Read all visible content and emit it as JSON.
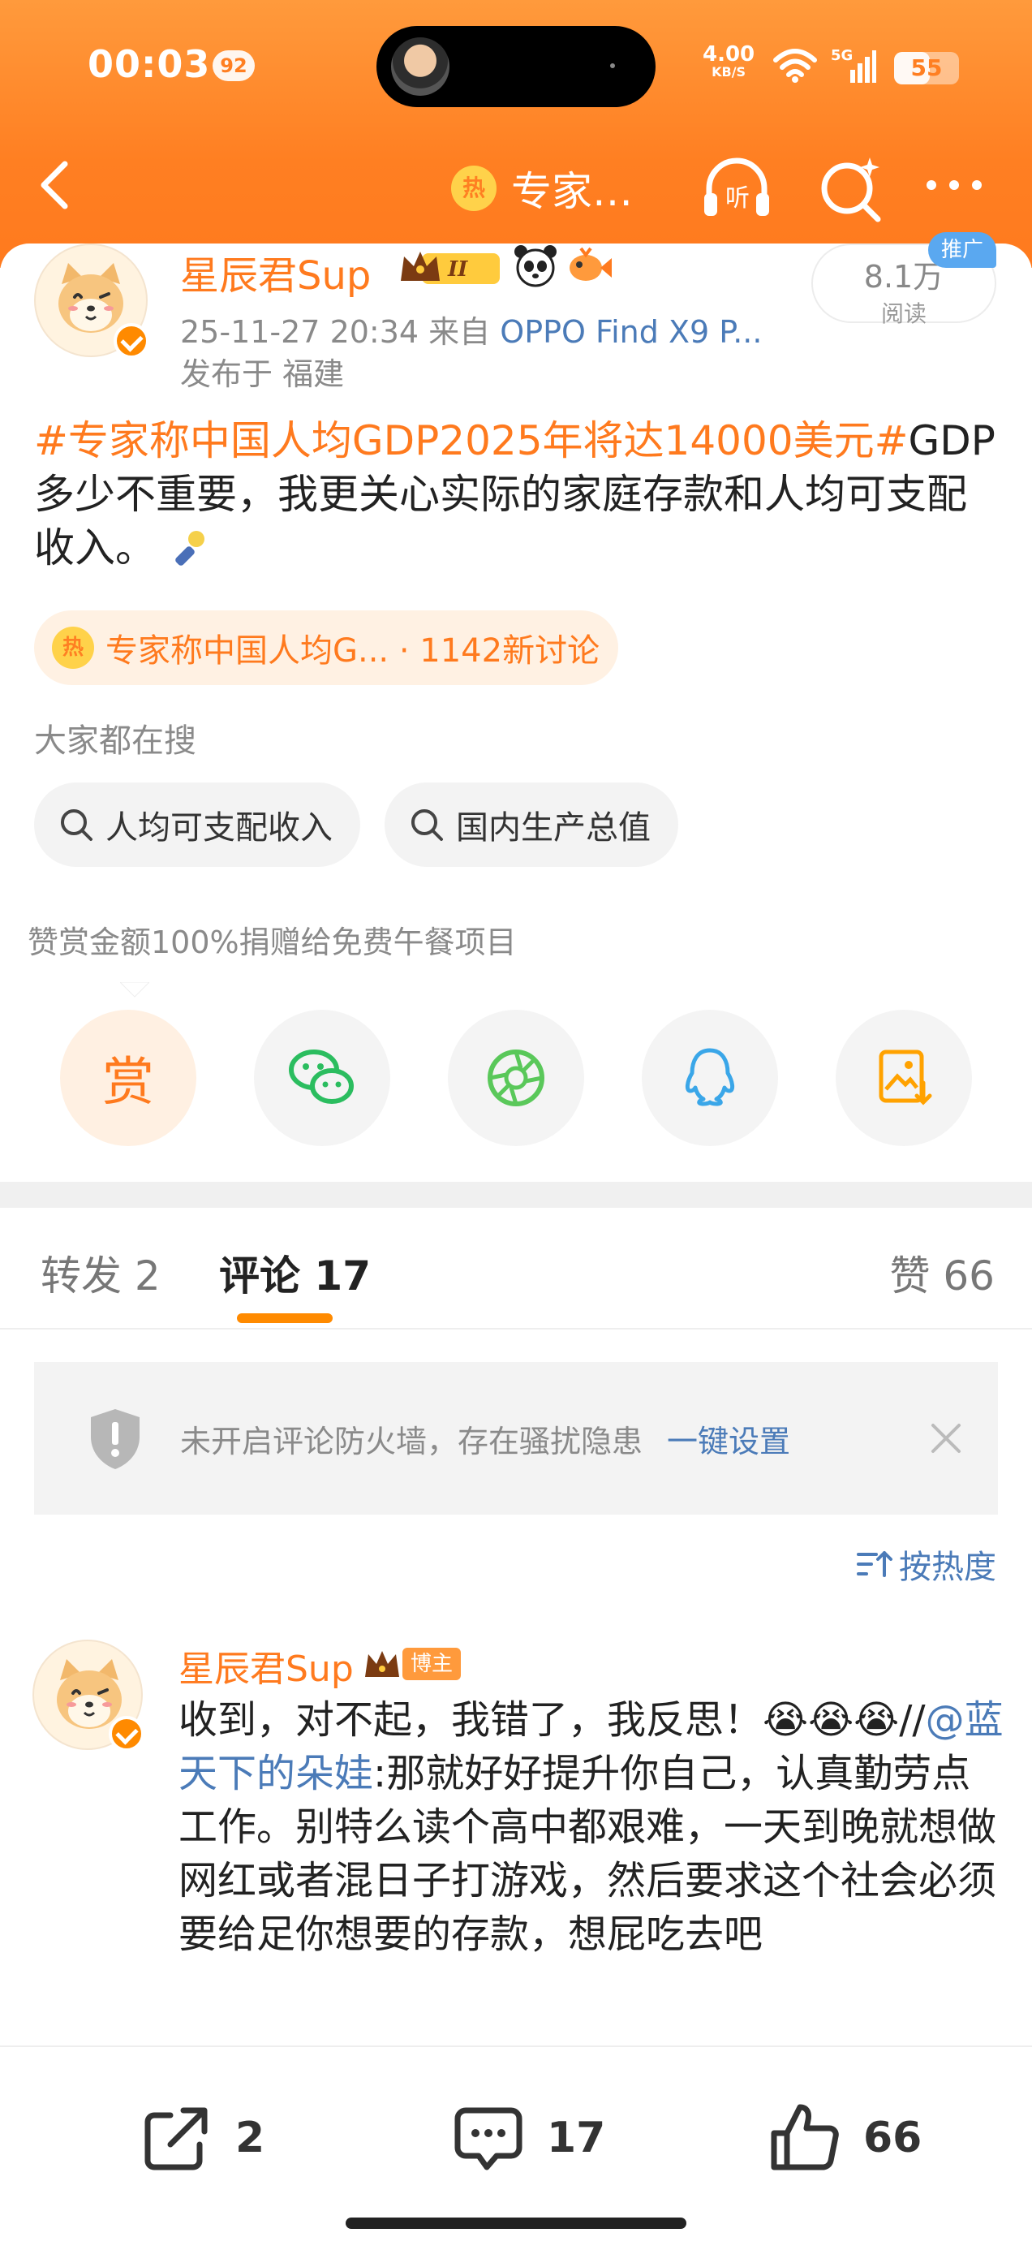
{
  "status_bar": {
    "time": "00:03",
    "badge": "92",
    "net_speed": "4.00",
    "net_unit": "KB/S",
    "network": "5G",
    "battery": "55",
    "battery_level": 55
  },
  "nav": {
    "title": "专家…",
    "hot_badge": "热",
    "listen_label": "听"
  },
  "post": {
    "author": "星辰君Sup",
    "level_badge": "II",
    "time": "25-11-27 20:34",
    "from_label": "来自",
    "device": "OPPO Find X9 P...",
    "location": "发布于 福建",
    "reads_count": "8.1万",
    "reads_label": "阅读",
    "ad_tag": "推广",
    "hashtag": "#专家称中国人均GDP2025年将达14000美元#",
    "text": "GDP多少不重要，我更关心实际的家庭存款和人均可支配收入。",
    "topic": "专家称中国人均G... · 1142新讨论",
    "search_label": "大家都在搜",
    "search_chips": [
      "人均可支配收入",
      "国内生产总值"
    ],
    "reward_note": "赞赏金额100%捐赠给免费午餐项目",
    "reward_label": "赏"
  },
  "tabs": {
    "repost": "转发 2",
    "comment": "评论 17",
    "like": "赞 66"
  },
  "firewall": {
    "text": "未开启评论防火墙，存在骚扰隐患",
    "link": "一键设置"
  },
  "sort_label": "按热度",
  "comment": {
    "author": "星辰君Sup",
    "tag": "博主",
    "text_start": "收到，对不起，我错了，我反思！😭😭😭//",
    "mention": "@蓝天下的朵娃",
    "text_rest": ":那就好好提升你自己，认真勤劳点工作。别特么读个高中都艰难，一天到晚就想做网红或者混日子打游戏，然后要求这个社会必须要给足你想要的存款，想屁吃去吧"
  },
  "bottom": {
    "share_count": "2",
    "comment_count": "17",
    "like_count": "66"
  }
}
